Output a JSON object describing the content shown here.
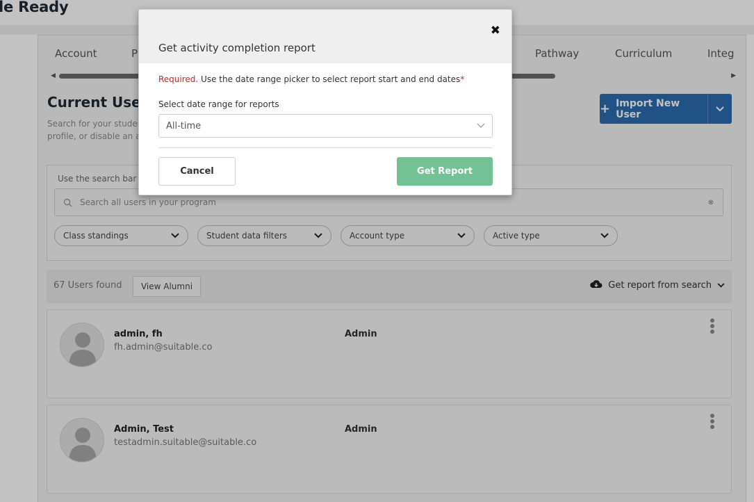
{
  "app": {
    "brand": "le Ready"
  },
  "tabs": [
    {
      "label": "Account"
    },
    {
      "label": "P"
    },
    {
      "label": "Pathway"
    },
    {
      "label": "Curriculum"
    },
    {
      "label": "Integ"
    }
  ],
  "section": {
    "title": "Current Users",
    "description": "Search for your studer profile, or disable an a"
  },
  "import_button": {
    "label": "Import New User",
    "icon": "plus-icon",
    "color": "#2b6cb0"
  },
  "search": {
    "hint": "Use the search bar",
    "placeholder": "Search all users in your program",
    "icon": "search-icon"
  },
  "filters": [
    {
      "label": "Class standings"
    },
    {
      "label": "Student data filters"
    },
    {
      "label": "Account type"
    },
    {
      "label": "Active type"
    }
  ],
  "results": {
    "count_text": "67 Users found",
    "alumni_button": "View Alumni",
    "report_link": "Get report from search",
    "report_icon": "cloud-download-icon"
  },
  "users": [
    {
      "name": "admin, fh",
      "email": "fh.admin@suitable.co",
      "role": "Admin"
    },
    {
      "name": "Admin, Test",
      "email": "testadmin.suitable@suitable.co",
      "role": "Admin"
    }
  ],
  "modal": {
    "title": "Get activity completion report",
    "close_icon": "close-icon",
    "required_word": "Required.",
    "required_text": " Use the date range picker to select report start and end dates",
    "required_star": "*",
    "field_label": "Select date range for reports",
    "select_value": "All-time",
    "cancel_label": "Cancel",
    "submit_label": "Get Report",
    "submit_color": "#72c296"
  }
}
